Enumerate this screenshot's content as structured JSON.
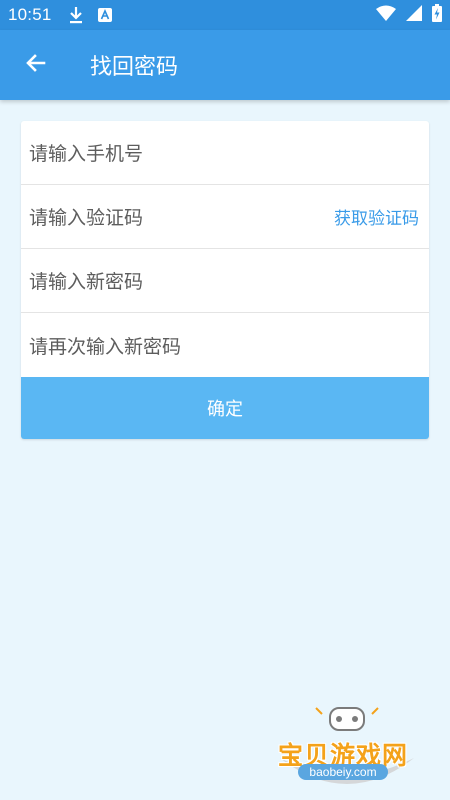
{
  "status_bar": {
    "time": "10:51",
    "icons": [
      "download-icon",
      "a-notification-icon",
      "wifi-icon",
      "signal-icon",
      "battery-charging-icon"
    ]
  },
  "app_bar": {
    "title": "找回密码",
    "back_icon": "arrow-left-icon"
  },
  "form": {
    "phone_placeholder": "请输入手机号",
    "code_placeholder": "请输入验证码",
    "get_code_label": "获取验证码",
    "new_password_placeholder": "请输入新密码",
    "confirm_password_placeholder": "请再次输入新密码",
    "submit_label": "确定"
  },
  "watermark": {
    "brand": "宝贝游戏网",
    "url": "baobeiy.com"
  },
  "colors": {
    "status_bar": "#2f8fdd",
    "app_bar": "#3a9be8",
    "background": "#e9f6fd",
    "button": "#5ab7f3",
    "link": "#3a9be8"
  }
}
